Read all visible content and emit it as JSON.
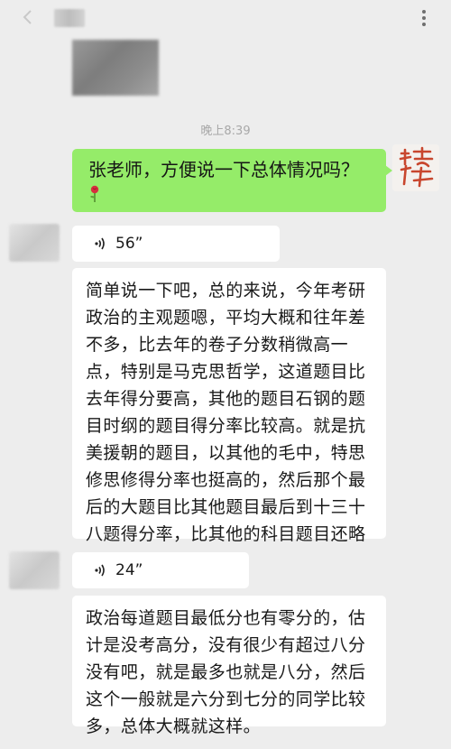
{
  "chat": {
    "time_label": "晚上8:39",
    "messages": [
      {
        "side": "right",
        "text": "张老师，方便说一下总体情况吗？",
        "emoji": "rose-icon"
      },
      {
        "side": "left",
        "type": "voice",
        "duration": "56”"
      },
      {
        "side": "left",
        "type": "text",
        "text": "简单说一下吧，总的来说，今年考研政治的主观题嗯，平均大概和往年差不多，比去年的卷子分数稍微高一点，特别是马克思哲学，这道题目比去年得分要高，其他的题目石钢的题目时纲的题目得分率比较高。就是抗美援朝的题目，以其他的毛中，特思修思修得分率也挺高的，然后那个最后的大题目比其他题目最后到十三十八题得分率，比其他的科目题目还略低一点。"
      },
      {
        "side": "left",
        "type": "voice",
        "duration": "24”"
      },
      {
        "side": "left",
        "type": "text",
        "text": "政治每道题目最低分也有零分的，估计是没考高分，没有很少有超过八分没有吧，就是最多也就是八分，然后这个一般就是六分到七分的同学比较多，总体大概就这样。"
      }
    ]
  },
  "self_avatar": {
    "glyph": "将"
  },
  "colors": {
    "background": "#ededed",
    "self_bubble": "#95ec69",
    "other_bubble": "#ffffff",
    "seal_red": "#c8462e"
  }
}
